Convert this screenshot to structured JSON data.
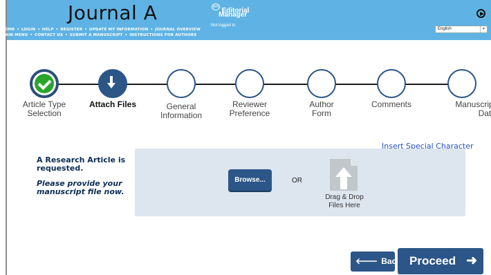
{
  "header": {
    "journal_title": "Journal A",
    "nav_line1": [
      "HOME",
      "LOGIN",
      "HELP",
      "REGISTER",
      "UPDATE MY INFORMATION",
      "JOURNAL OVERVIEW"
    ],
    "nav_line2": [
      "MAIN MENU",
      "CONTACT US",
      "SUBMIT A MANUSCRIPT",
      "INSTRUCTIONS FOR AUTHORS"
    ],
    "logo_badge": "em",
    "logo_word1": "Editorial",
    "logo_word2": "Manager",
    "login_status": "Not logged in.",
    "language": "English",
    "icons": {
      "play": "play-circle-icon",
      "dropdown": "chevron-down-icon"
    }
  },
  "steps": [
    {
      "label_line1": "Article Type",
      "label_line2": "Selection",
      "state": "done"
    },
    {
      "label_line1": "Attach Files",
      "label_line2": "",
      "state": "current"
    },
    {
      "label_line1": "General",
      "label_line2": "Information",
      "state": "pending"
    },
    {
      "label_line1": "Reviewer",
      "label_line2": "Preference",
      "state": "pending"
    },
    {
      "label_line1": "Author",
      "label_line2": "Form",
      "state": "pending"
    },
    {
      "label_line1": "Comments",
      "label_line2": "",
      "state": "pending"
    },
    {
      "label_line1": "Manuscript",
      "label_line2": "Data",
      "state": "pending"
    }
  ],
  "main": {
    "special_char_link": "Insert Special Character",
    "request_line1": "A Research Article is",
    "request_line2": "requested.",
    "prompt_line1": "Please provide your",
    "prompt_line2": "manuscript file now.",
    "browse_label": "Browse...",
    "or_label": "OR",
    "drop_line1": "Drag & Drop",
    "drop_line2": "Files Here"
  },
  "footer": {
    "back_label": "Back",
    "proceed_label": "Proceed"
  },
  "colors": {
    "header_bg": "#5fb3e4",
    "primary": "#2b5687",
    "success": "#29a52c",
    "panel_bg": "#dde5ee",
    "link": "#2850c6"
  }
}
